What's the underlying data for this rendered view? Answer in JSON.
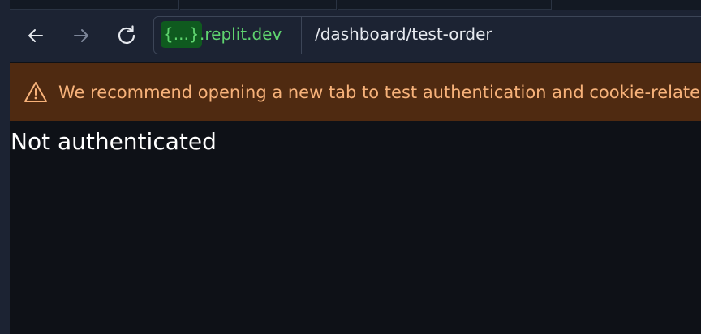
{
  "browser": {
    "url": {
      "host_placeholder": "{...}",
      "host_domain": ".replit.dev",
      "path": "/dashboard/test-order"
    },
    "icons": {
      "back": "arrow-left-icon",
      "forward": "arrow-right-icon",
      "reload": "reload-icon",
      "warning": "warning-triangle-icon"
    }
  },
  "warning_banner": {
    "text": "We recommend opening a new tab to test authentication and cookie-related"
  },
  "page": {
    "message": "Not authenticated"
  },
  "colors": {
    "background": "#0e1117",
    "toolbar": "#1c2333",
    "host_accent": "#5fd46f",
    "warning_bg": "#4f2a11",
    "warning_text": "#f7b27a"
  }
}
